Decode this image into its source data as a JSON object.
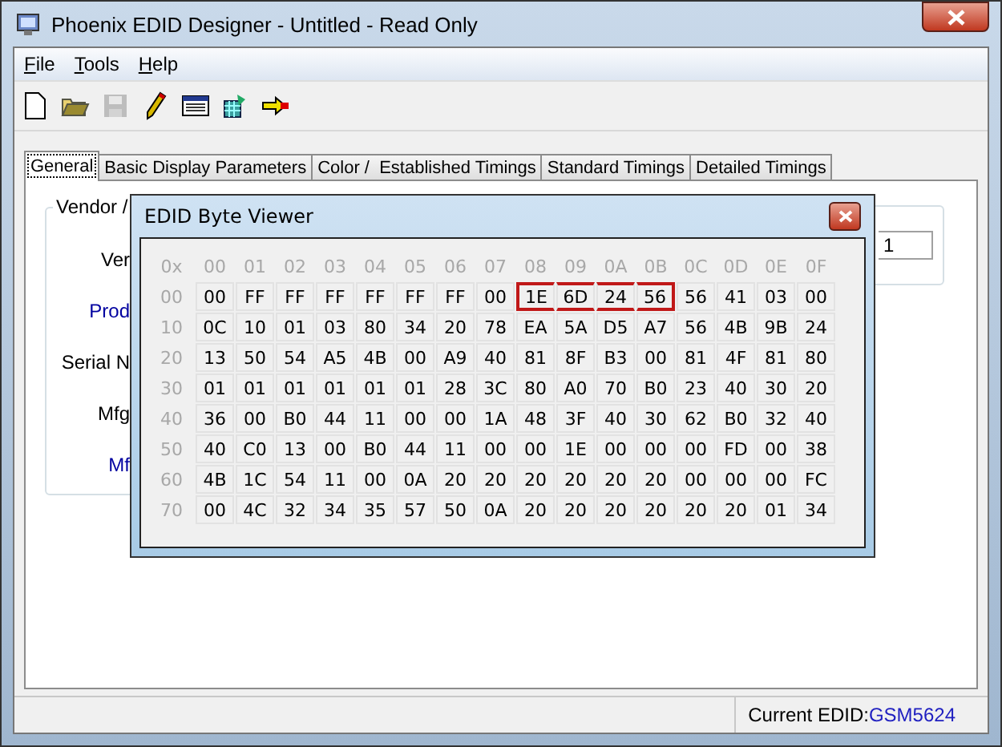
{
  "window": {
    "title": "Phoenix EDID Designer - Untitled - Read Only"
  },
  "menu": [
    {
      "label": "File"
    },
    {
      "label": "Tools"
    },
    {
      "label": "Help"
    }
  ],
  "toolbar": [
    {
      "kind": "new",
      "disabled": false
    },
    {
      "kind": "open",
      "disabled": false
    },
    {
      "kind": "save",
      "disabled": true
    },
    {
      "kind": "pencil",
      "disabled": false
    },
    {
      "kind": "viewer",
      "disabled": false
    },
    {
      "kind": "build",
      "disabled": false
    },
    {
      "kind": "arrow",
      "disabled": false
    }
  ],
  "tabs": [
    {
      "label": "General",
      "selected": true
    },
    {
      "label": "Basic Display Parameters",
      "selected": false
    },
    {
      "label": "Color /  Established Timings",
      "selected": false
    },
    {
      "label": "Standard Timings",
      "selected": false
    },
    {
      "label": "Detailed Timings",
      "selected": false
    }
  ],
  "general": {
    "group_title": "Vendor /",
    "labels": [
      "Ver",
      "Prod",
      "Serial N",
      "Mfg",
      "Mf"
    ],
    "field_value": "1"
  },
  "byte_viewer": {
    "title": "EDID Byte Viewer",
    "corner": "0x",
    "columns": [
      "00",
      "01",
      "02",
      "03",
      "04",
      "05",
      "06",
      "07",
      "08",
      "09",
      "0A",
      "0B",
      "0C",
      "0D",
      "0E",
      "0F"
    ],
    "rows": [
      {
        "label": "00",
        "bytes": [
          {
            "value": "00",
            "selected": false
          },
          {
            "value": "FF",
            "selected": false
          },
          {
            "value": "FF",
            "selected": false
          },
          {
            "value": "FF",
            "selected": false
          },
          {
            "value": "FF",
            "selected": false
          },
          {
            "value": "FF",
            "selected": false
          },
          {
            "value": "FF",
            "selected": false
          },
          {
            "value": "00",
            "selected": false
          },
          {
            "value": "1E",
            "selected": true
          },
          {
            "value": "6D",
            "selected": true
          },
          {
            "value": "24",
            "selected": true
          },
          {
            "value": "56",
            "selected": true
          },
          {
            "value": "56",
            "selected": false
          },
          {
            "value": "41",
            "selected": false
          },
          {
            "value": "03",
            "selected": false
          },
          {
            "value": "00",
            "selected": false
          }
        ]
      },
      {
        "label": "10",
        "bytes": [
          {
            "value": "0C",
            "selected": false
          },
          {
            "value": "10",
            "selected": false
          },
          {
            "value": "01",
            "selected": false
          },
          {
            "value": "03",
            "selected": false
          },
          {
            "value": "80",
            "selected": false
          },
          {
            "value": "34",
            "selected": false
          },
          {
            "value": "20",
            "selected": false
          },
          {
            "value": "78",
            "selected": false
          },
          {
            "value": "EA",
            "selected": false
          },
          {
            "value": "5A",
            "selected": false
          },
          {
            "value": "D5",
            "selected": false
          },
          {
            "value": "A7",
            "selected": false
          },
          {
            "value": "56",
            "selected": false
          },
          {
            "value": "4B",
            "selected": false
          },
          {
            "value": "9B",
            "selected": false
          },
          {
            "value": "24",
            "selected": false
          }
        ]
      },
      {
        "label": "20",
        "bytes": [
          {
            "value": "13",
            "selected": false
          },
          {
            "value": "50",
            "selected": false
          },
          {
            "value": "54",
            "selected": false
          },
          {
            "value": "A5",
            "selected": false
          },
          {
            "value": "4B",
            "selected": false
          },
          {
            "value": "00",
            "selected": false
          },
          {
            "value": "A9",
            "selected": false
          },
          {
            "value": "40",
            "selected": false
          },
          {
            "value": "81",
            "selected": false
          },
          {
            "value": "8F",
            "selected": false
          },
          {
            "value": "B3",
            "selected": false
          },
          {
            "value": "00",
            "selected": false
          },
          {
            "value": "81",
            "selected": false
          },
          {
            "value": "4F",
            "selected": false
          },
          {
            "value": "81",
            "selected": false
          },
          {
            "value": "80",
            "selected": false
          }
        ]
      },
      {
        "label": "30",
        "bytes": [
          {
            "value": "01",
            "selected": false
          },
          {
            "value": "01",
            "selected": false
          },
          {
            "value": "01",
            "selected": false
          },
          {
            "value": "01",
            "selected": false
          },
          {
            "value": "01",
            "selected": false
          },
          {
            "value": "01",
            "selected": false
          },
          {
            "value": "28",
            "selected": false
          },
          {
            "value": "3C",
            "selected": false
          },
          {
            "value": "80",
            "selected": false
          },
          {
            "value": "A0",
            "selected": false
          },
          {
            "value": "70",
            "selected": false
          },
          {
            "value": "B0",
            "selected": false
          },
          {
            "value": "23",
            "selected": false
          },
          {
            "value": "40",
            "selected": false
          },
          {
            "value": "30",
            "selected": false
          },
          {
            "value": "20",
            "selected": false
          }
        ]
      },
      {
        "label": "40",
        "bytes": [
          {
            "value": "36",
            "selected": false
          },
          {
            "value": "00",
            "selected": false
          },
          {
            "value": "B0",
            "selected": false
          },
          {
            "value": "44",
            "selected": false
          },
          {
            "value": "11",
            "selected": false
          },
          {
            "value": "00",
            "selected": false
          },
          {
            "value": "00",
            "selected": false
          },
          {
            "value": "1A",
            "selected": false
          },
          {
            "value": "48",
            "selected": false
          },
          {
            "value": "3F",
            "selected": false
          },
          {
            "value": "40",
            "selected": false
          },
          {
            "value": "30",
            "selected": false
          },
          {
            "value": "62",
            "selected": false
          },
          {
            "value": "B0",
            "selected": false
          },
          {
            "value": "32",
            "selected": false
          },
          {
            "value": "40",
            "selected": false
          }
        ]
      },
      {
        "label": "50",
        "bytes": [
          {
            "value": "40",
            "selected": false
          },
          {
            "value": "C0",
            "selected": false
          },
          {
            "value": "13",
            "selected": false
          },
          {
            "value": "00",
            "selected": false
          },
          {
            "value": "B0",
            "selected": false
          },
          {
            "value": "44",
            "selected": false
          },
          {
            "value": "11",
            "selected": false
          },
          {
            "value": "00",
            "selected": false
          },
          {
            "value": "00",
            "selected": false
          },
          {
            "value": "1E",
            "selected": false
          },
          {
            "value": "00",
            "selected": false
          },
          {
            "value": "00",
            "selected": false
          },
          {
            "value": "00",
            "selected": false
          },
          {
            "value": "FD",
            "selected": false
          },
          {
            "value": "00",
            "selected": false
          },
          {
            "value": "38",
            "selected": false
          }
        ]
      },
      {
        "label": "60",
        "bytes": [
          {
            "value": "4B",
            "selected": false
          },
          {
            "value": "1C",
            "selected": false
          },
          {
            "value": "54",
            "selected": false
          },
          {
            "value": "11",
            "selected": false
          },
          {
            "value": "00",
            "selected": false
          },
          {
            "value": "0A",
            "selected": false
          },
          {
            "value": "20",
            "selected": false
          },
          {
            "value": "20",
            "selected": false
          },
          {
            "value": "20",
            "selected": false
          },
          {
            "value": "20",
            "selected": false
          },
          {
            "value": "20",
            "selected": false
          },
          {
            "value": "20",
            "selected": false
          },
          {
            "value": "00",
            "selected": false
          },
          {
            "value": "00",
            "selected": false
          },
          {
            "value": "00",
            "selected": false
          },
          {
            "value": "FC",
            "selected": false
          }
        ]
      },
      {
        "label": "70",
        "bytes": [
          {
            "value": "00",
            "selected": false
          },
          {
            "value": "4C",
            "selected": false
          },
          {
            "value": "32",
            "selected": false
          },
          {
            "value": "34",
            "selected": false
          },
          {
            "value": "35",
            "selected": false
          },
          {
            "value": "57",
            "selected": false
          },
          {
            "value": "50",
            "selected": false
          },
          {
            "value": "0A",
            "selected": false
          },
          {
            "value": "20",
            "selected": false
          },
          {
            "value": "20",
            "selected": false
          },
          {
            "value": "20",
            "selected": false
          },
          {
            "value": "20",
            "selected": false
          },
          {
            "value": "20",
            "selected": false
          },
          {
            "value": "20",
            "selected": false
          },
          {
            "value": "01",
            "selected": false
          },
          {
            "value": "34",
            "selected": false
          }
        ]
      }
    ]
  },
  "status_bar": {
    "label": "Current EDID:",
    "value": "GSM5624"
  }
}
